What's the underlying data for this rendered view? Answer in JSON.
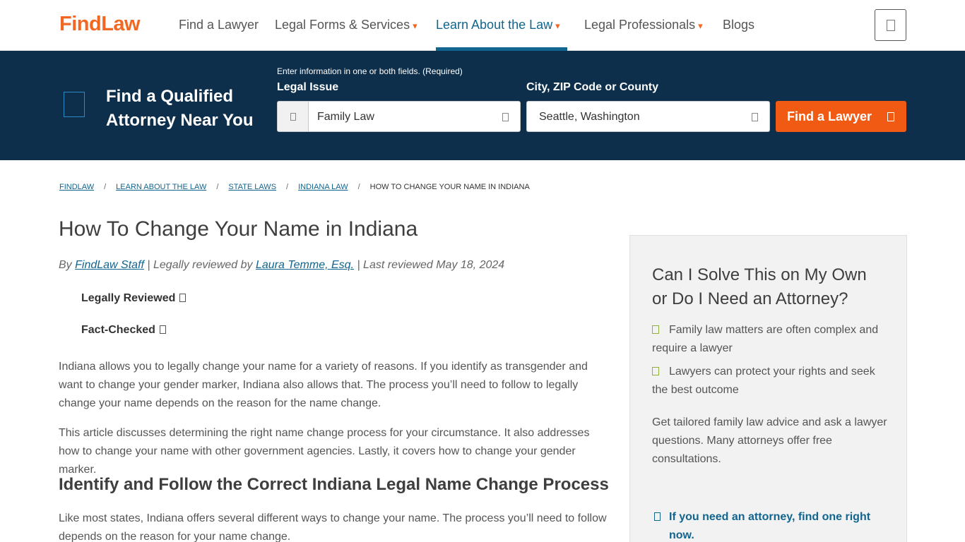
{
  "header": {
    "logo": "FindLaw",
    "nav": [
      {
        "label": "Find a Lawyer",
        "caret": false
      },
      {
        "label": "Legal Forms & Services",
        "caret": true
      },
      {
        "label": "Learn About the Law",
        "caret": true,
        "active": true
      },
      {
        "label": "Legal Professionals",
        "caret": true
      },
      {
        "label": "Blogs",
        "caret": false
      }
    ],
    "menu_icon": "menu-icon"
  },
  "search": {
    "title": "Find a Qualified Attorney Near You",
    "hint": "Enter information in one or both fields. (Required)",
    "legal_issue_label": "Legal Issue",
    "legal_issue_value": "Family Law",
    "location_label": "City, ZIP Code or County",
    "location_value": "Seattle, Washington",
    "button_label": "Find a Lawyer"
  },
  "breadcrumb": [
    {
      "label": "FINDLAW",
      "link": true
    },
    {
      "label": "LEARN ABOUT THE LAW",
      "link": true
    },
    {
      "label": "STATE LAWS",
      "link": true
    },
    {
      "label": "INDIANA LAW",
      "link": true
    },
    {
      "label": "HOW TO CHANGE YOUR NAME IN INDIANA",
      "link": false
    }
  ],
  "article": {
    "title": "How To Change Your Name in Indiana",
    "byline_prefix": "By",
    "author": "FindLaw Staff",
    "reviewed_prefix": " | Legally reviewed by ",
    "reviewer": "Laura Temme, Esq.",
    "last_reviewed": " | Last reviewed May 18, 2024",
    "badge_reviewed": "Legally Reviewed",
    "badge_checked": "Fact-Checked",
    "p1": "Indiana allows you to legally change your name for a variety of reasons. If you identify as transgender and want to change your gender marker, Indiana also allows that. The process you’ll need to follow to legally change your name depends on the reason for the name change.",
    "p2": "This article discusses determining the right name change process for your circumstance. It also addresses how to change your name with other government agencies. Lastly, it covers how to change your gender marker.",
    "h2": "Identify and Follow the Correct Indiana Legal Name Change Process",
    "p3": "Like most states, Indiana offers several different ways to change your name. The process you’ll need to follow depends on the reason for your name change."
  },
  "sidebar": {
    "title": "Can I Solve This on My Own or Do I Need an Attorney?",
    "bullets": [
      "Family law matters are often complex and require a lawyer",
      "Lawyers can protect your rights and seek the best outcome"
    ],
    "text": "Get tailored family law advice and ask a lawyer questions. Many attorneys offer free consultations.",
    "link": "If you need an attorney, find one right now."
  },
  "colors": {
    "brand": "#f26722",
    "navy": "#0d2f4b",
    "link": "#12658e",
    "button": "#f15a13"
  }
}
